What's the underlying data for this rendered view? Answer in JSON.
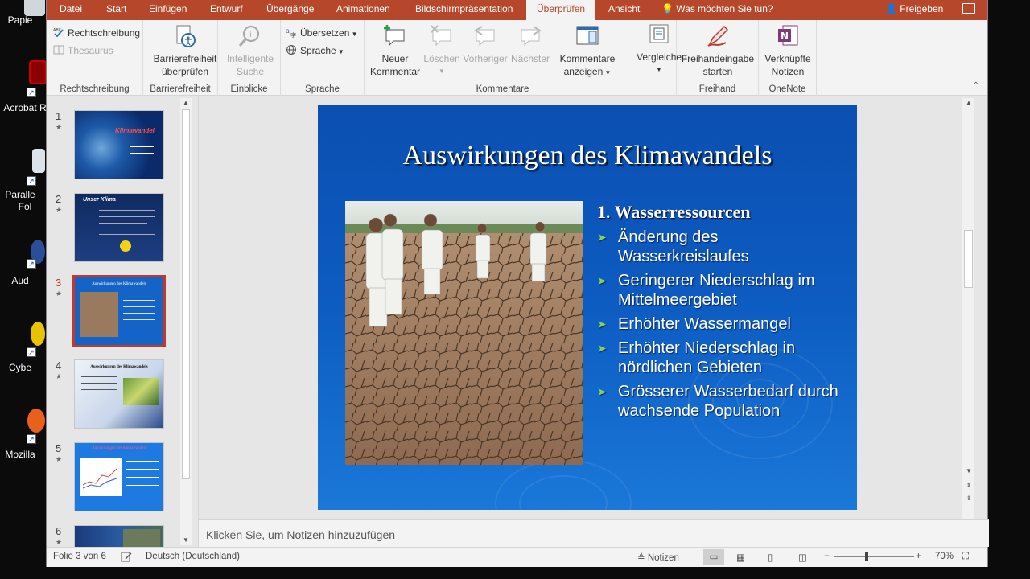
{
  "desktop": {
    "icons": [
      {
        "label": "Papie"
      },
      {
        "label": "Acrobat R"
      },
      {
        "label": "Paralle"
      },
      {
        "label": "Fol"
      },
      {
        "label": "Aud"
      },
      {
        "label": "Cybe"
      },
      {
        "label": "Mozilla"
      }
    ]
  },
  "tabs": [
    {
      "label": "Datei"
    },
    {
      "label": "Start"
    },
    {
      "label": "Einfügen"
    },
    {
      "label": "Entwurf"
    },
    {
      "label": "Übergänge"
    },
    {
      "label": "Animationen"
    },
    {
      "label": "Bildschirmpräsentation"
    },
    {
      "label": "Überprüfen"
    },
    {
      "label": "Ansicht"
    }
  ],
  "tellme": "Was möchten Sie tun?",
  "share": "Freigeben",
  "ribbon": {
    "groups": [
      {
        "label": "Rechtschreibung"
      },
      {
        "label": "Barrierefreiheit"
      },
      {
        "label": "Einblicke"
      },
      {
        "label": "Sprache"
      },
      {
        "label": "Kommentare"
      },
      {
        "label": "Freihand"
      },
      {
        "label": "OneNote"
      }
    ],
    "rechtschreibung": "Rechtschreibung",
    "thesaurus": "Thesaurus",
    "barriere_l1": "Barrierefreiheit",
    "barriere_l2": "überprüfen",
    "smart_l1": "Intelligente",
    "smart_l2": "Suche",
    "uebersetzen": "Übersetzen",
    "sprache": "Sprache",
    "neu_l1": "Neuer",
    "neu_l2": "Kommentar",
    "loeschen": "Löschen",
    "vorheriger": "Vorheriger",
    "naechster": "Nächster",
    "kanz_l1": "Kommentare",
    "kanz_l2": "anzeigen",
    "vergleichen": "Vergleichen",
    "freihand_l1": "Freihandeingabe",
    "freihand_l2": "starten",
    "onenote_l1": "Verknüpfte",
    "onenote_l2": "Notizen"
  },
  "thumbnails": [
    {
      "num": "1",
      "title": "Klimawandel"
    },
    {
      "num": "2",
      "title": "Unser Klima"
    },
    {
      "num": "3",
      "title": "Auswirkungen des Klimawandels"
    },
    {
      "num": "4",
      "title": "Auswirkungen des Klimawandels"
    },
    {
      "num": "5",
      "title": "Auswirkungen des Klimawandels"
    },
    {
      "num": "6",
      "title": ""
    }
  ],
  "slide": {
    "title": "Auswirkungen des Klimawandels",
    "heading": "1. Wasserressourcen",
    "bullets": [
      "Änderung des Wasserkreislaufes",
      "Geringerer Niederschlag im Mittelmeergebiet",
      "Erhöhter Wassermangel",
      "Erhöhter Niederschlag in nördlichen Gebieten",
      "Grösserer Wasserbedarf durch wachsende Population"
    ]
  },
  "notes_placeholder": "Klicken Sie, um Notizen hinzuzufügen",
  "status": {
    "slide_info": "Folie 3 von 6",
    "language": "Deutsch (Deutschland)",
    "notes": "Notizen",
    "zoom": "70%",
    "zoom_level": 0.7
  },
  "colors": {
    "accent": "#b7472a",
    "slide_bg": "#0d5cc2",
    "bullet_chevron": "#7fd35b"
  }
}
